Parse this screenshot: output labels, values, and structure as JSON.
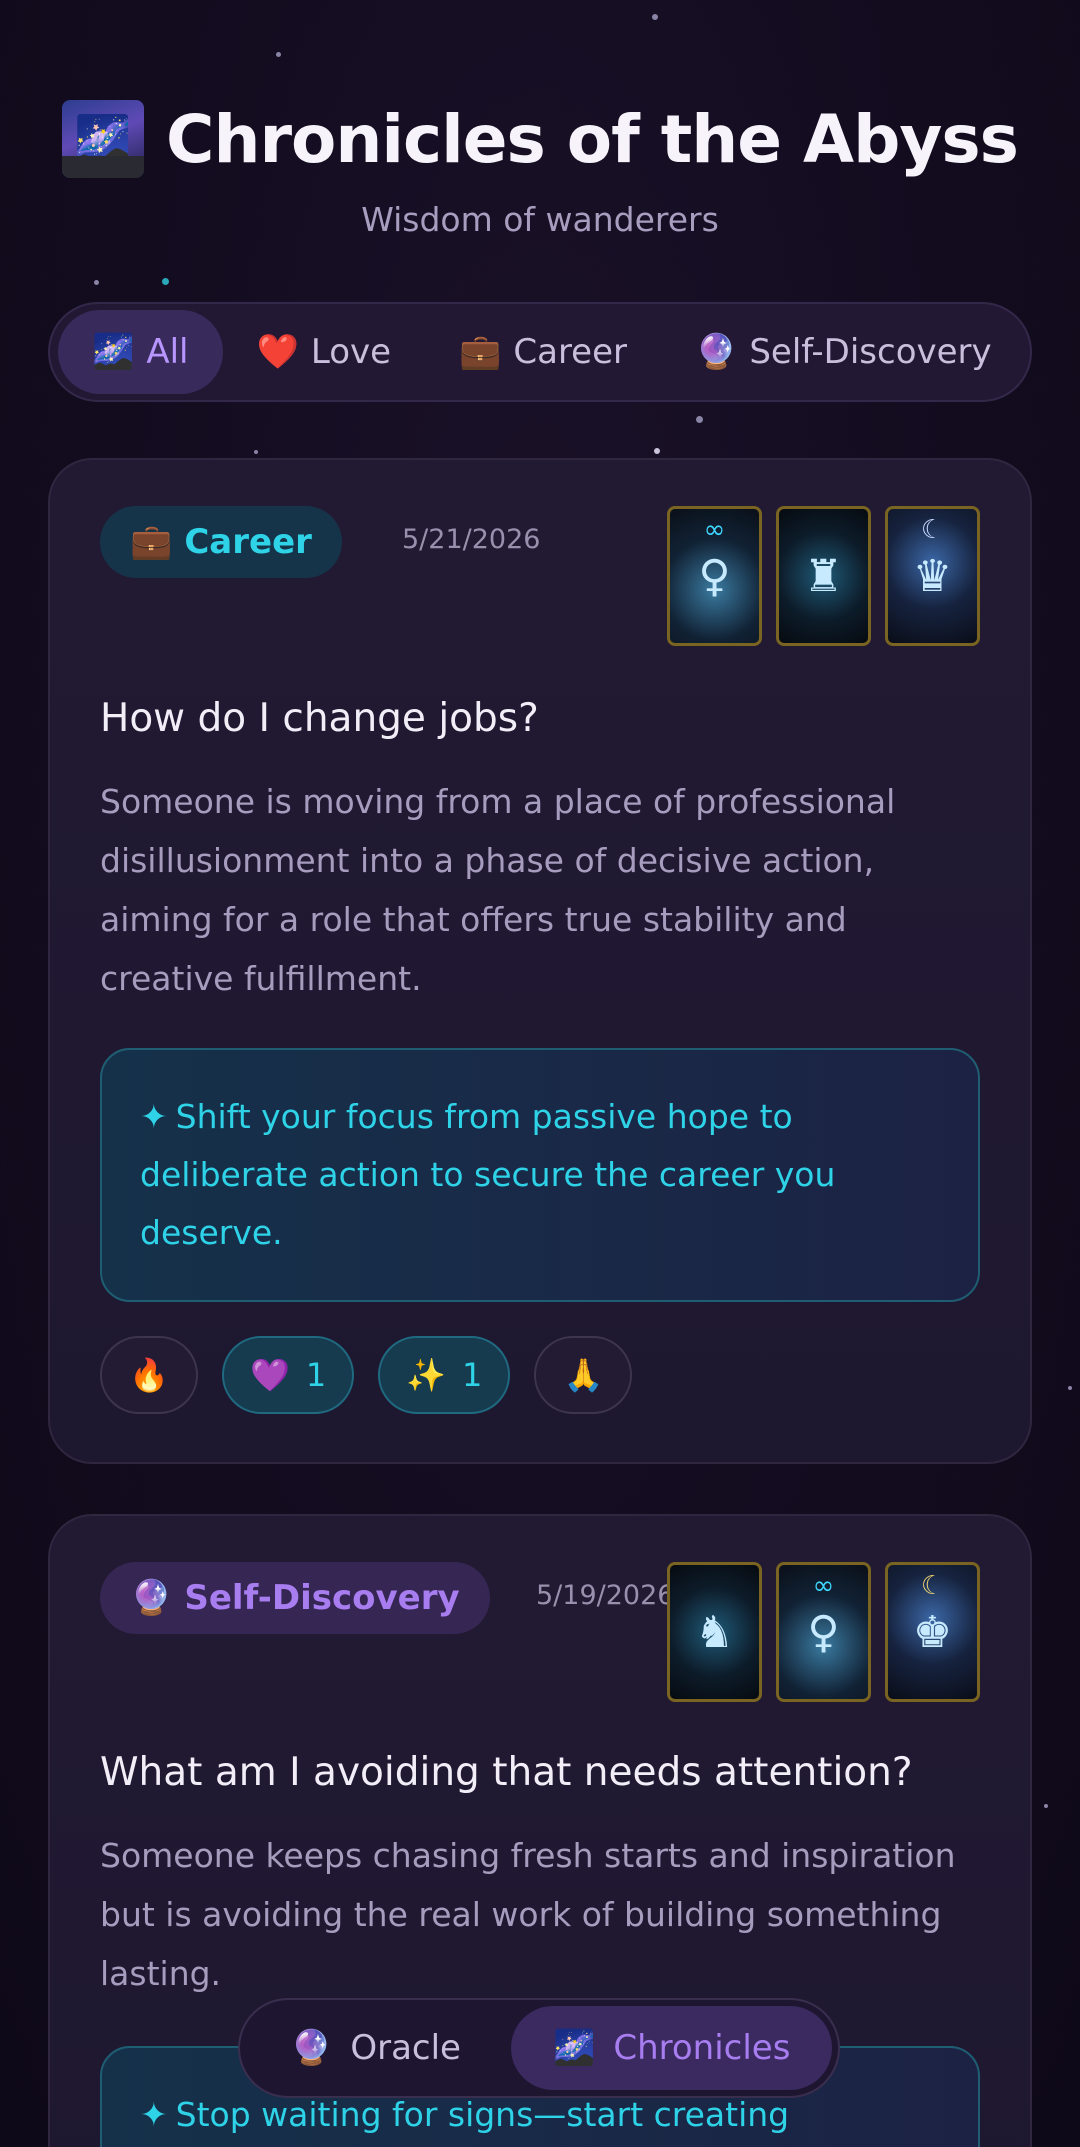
{
  "header": {
    "emoji": "🌌",
    "title": "Chronicles of the Abyss",
    "subtitle": "Wisdom of wanderers"
  },
  "filters": [
    {
      "icon": "🌌",
      "label": "All",
      "active": true
    },
    {
      "icon": "❤️",
      "label": "Love",
      "active": false
    },
    {
      "icon": "💼",
      "label": "Career",
      "active": false
    },
    {
      "icon": "🔮",
      "label": "Self-Discovery",
      "active": false
    }
  ],
  "entries": [
    {
      "category_icon": "💼",
      "category": "Career",
      "date": "5/21/2026",
      "question": "How do I change jobs?",
      "summary": "Someone is moving from a place of professional disillusionment into a phase of decisive action, aiming for a role that offers true stability and creative fulfillment.",
      "insight_icon": "✦",
      "insight": "Shift your focus from passive hope to deliberate action to secure the career you deserve.",
      "reactions": [
        {
          "emoji": "🔥",
          "count": ""
        },
        {
          "emoji": "💜",
          "count": "1"
        },
        {
          "emoji": "✨",
          "count": "1"
        },
        {
          "emoji": "🙏",
          "count": ""
        }
      ],
      "tarot_symbols": [
        "∞",
        "",
        "☾"
      ]
    },
    {
      "category_icon": "🔮",
      "category": "Self-Discovery",
      "date": "5/19/2026",
      "question": "What am I avoiding that needs attention?",
      "summary": "Someone keeps chasing fresh starts and inspiration but is avoiding the real work of building something lasting.",
      "insight_icon": "✦",
      "insight": "Stop waiting for signs—start creating",
      "tarot_symbols": [
        "",
        "∞",
        "☾"
      ]
    }
  ],
  "bottom_nav": [
    {
      "icon": "🔮",
      "label": "Oracle",
      "active": false
    },
    {
      "icon": "🌌",
      "label": "Chronicles",
      "active": true
    }
  ]
}
